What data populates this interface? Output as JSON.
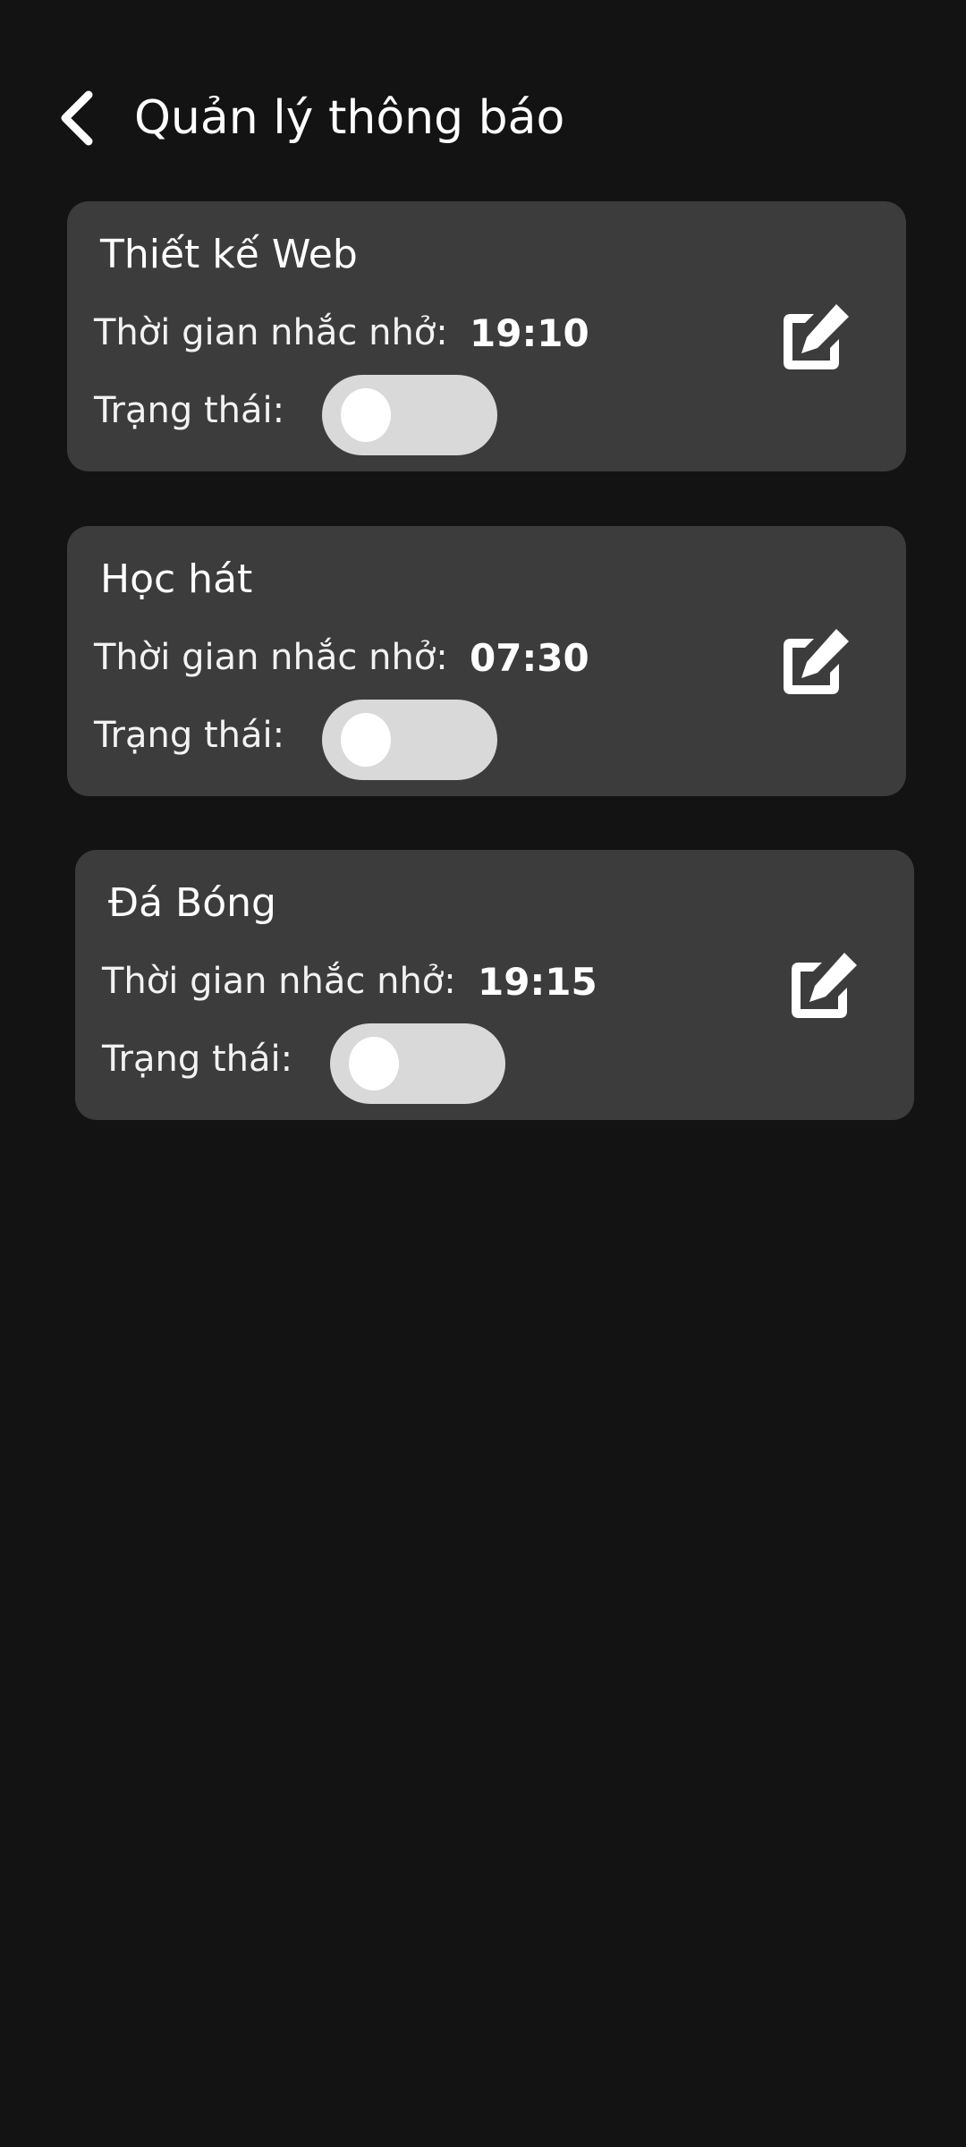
{
  "header": {
    "title": "Quản lý thông báo",
    "back_icon": "chevron-left-icon"
  },
  "colors": {
    "background": "#131313",
    "card": "#3c3c3c",
    "toggle_track": "#d9d9d9",
    "toggle_knob": "#ffffff",
    "text": "#ffffff"
  },
  "notifications": [
    {
      "title": "Thiết kế Web",
      "time_label": "Thời gian nhắc nhở:",
      "time": "19:10",
      "status_label": "Trạng thái:",
      "enabled": false,
      "edit_icon": "edit-icon"
    },
    {
      "title": "Học hát",
      "time_label": "Thời gian nhắc nhở:",
      "time": "07:30",
      "status_label": "Trạng thái:",
      "enabled": false,
      "edit_icon": "edit-icon"
    },
    {
      "title": "Đá Bóng",
      "time_label": "Thời gian nhắc nhở:",
      "time": "19:15",
      "status_label": "Trạng thái:",
      "enabled": false,
      "edit_icon": "edit-icon"
    }
  ]
}
